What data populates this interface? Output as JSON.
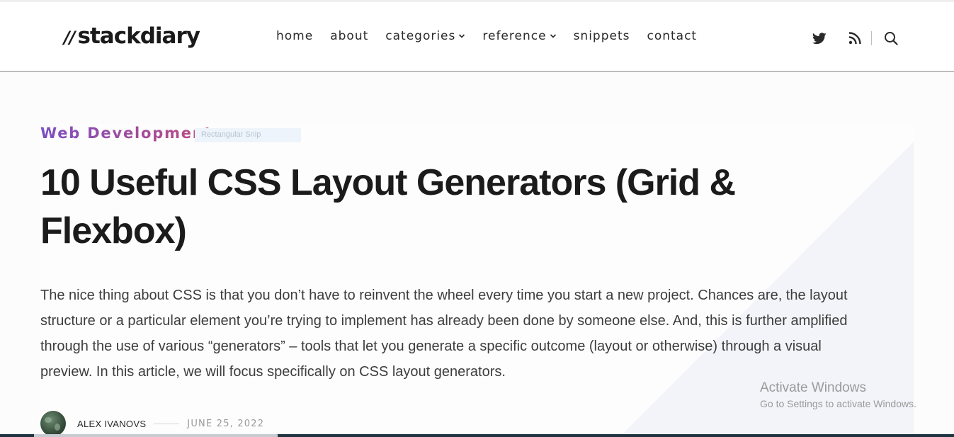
{
  "header": {
    "logo_slashes": "//",
    "logo_text": "stackdiary",
    "nav": {
      "home": "home",
      "about": "about",
      "categories": "categories",
      "reference": "reference",
      "snippets": "snippets",
      "contact": "contact"
    },
    "icons": [
      "twitter-icon",
      "rss-icon",
      "search-icon"
    ]
  },
  "article": {
    "category": "Web Development",
    "title": "10 Useful CSS Layout Generators (Grid & Flexbox)",
    "intro": "The nice thing about CSS is that you don’t have to reinvent the wheel every time you start a new project. Chances are, the layout structure or a particular element you’re trying to implement has already been done by someone else. And, this is further amplified through the use of various “generators” – tools that let you generate a specific outcome (layout or otherwise) through a visual preview. In this article, we will focus specifically on CSS layout generators.",
    "author": "ALEX IVANOVS",
    "date": "JUNE 25, 2022"
  },
  "overlay": {
    "snip_label": "Rectangular Snip",
    "activate_title": "Activate Windows",
    "activate_sub": "Go to Settings to activate Windows."
  },
  "colors": {
    "category_gradient_start": "#7b4fc4",
    "category_gradient_end": "#c04a7e",
    "bottom_bar": "#1f3340",
    "header_border": "#8a8a8a"
  }
}
